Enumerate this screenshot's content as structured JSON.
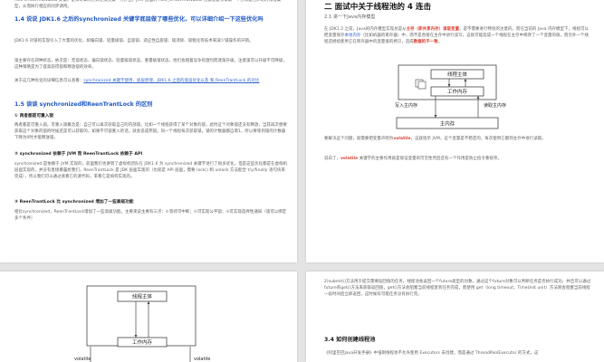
{
  "top_left": {
    "intro": "ACC SYNCHRONIZED 关键，使得可靠的方式更加完美一点并且，JVM 层面的 ACC_SYNCHRONIZED 也都会是有帮助一个方法是否声明的线程类型，从而执行相应的同步调用。",
    "s14_title": "1.4 说说 JDK1.6 之后的synchronized 关键字底层做了哪些优化，可以详细介绍一下这些优化吗",
    "s14_p1": "JDK1.6 对锁的实现引入了大量的优化，如偏向锁、轻量级锁、自旋锁、适应性自旋锁、锁消除、锁粗化等技术来减少锁操作的开销。",
    "s14_p2": "锁主要存在四种状态，依次是：无锁状态、偏向锁状态、轻量级锁状态、重量级锁状态，他们会随着竞争的激烈而逐渐升级。注意锁可以升级不可降级，这种策略是为了提高获得锁和释放锁的效率。",
    "s14_p3_prefix": "关于这几种优化的详细信息可以查看：",
    "s14_p3_link": "synchronized 关键字使用、底层原理、JDK1.6 之后的底层优化以及 和 ReenTrantLock 的对比",
    "s15_title": "1.5 谈谈 synchronized和ReenTrantLock 的区别",
    "s15_h1": "① 两者都是可重入锁",
    "s15_p1": "两者都是可重入锁。可重入锁概念是：自己可以再次获取自己的内部锁。比如一个线程获得了某个对象的锁，此时这个对象锁还没有释放，当其再次想要获取这个对象的锁的时候还是可以获取的，如果不可锁重入的话，就会造成死锁。同一个线程每次获取锁，锁的计数器都自增1，所以要等到锁的计数器下降为0时才能释放锁。",
    "s15_h2": "② synchronized 依赖于 JVM 而 ReenTrantLock 依赖于 API",
    "s15_p2": "synchronized 是依赖于 JVM 实现的，前面我们也讲到了虚拟机团队在 JDK1.6 为 synchronized 关键字进行了很多优化，但是这些优化都是在虚拟机层面实现的，并没有直接暴露给我们。ReenTrantLock 是 JDK 层面实现的（也就是 API 层面，需要 lock() 和 unlock 方法配合 try/finally 语句块来完成），所以我们可以通过查看它的源代码，来看它是如何实现的。",
    "s15_h3": "③ ReenTrantLock 比 synchronized 增加了一些高级功能",
    "s15_p3": "相比synchronized，ReenTrantLock增加了一些高级功能。主要来说主要有三点：①等待可中断；②可实现公平锁；③可实现选择性通知（锁可以绑定多个条件）"
  },
  "top_right": {
    "section_title": "二 面试中关于线程池的 4 连击",
    "sub_title": "2.1 讲一下Java内存模型",
    "p1_a": "在 JDK1.2 之前，Java的内存模型实现总是从",
    "p1_red1": "主存（即共享内存）读取变量",
    "p1_b": "，是不需要进行特别的注意的。而在当前的 Java 内存模型下，线程可以把变量保存",
    "p1_blue": "本地内存",
    "p1_c": "（比如机器的寄存器）中，而不是直接在主存中进行读写。这就可能造成一个线程在主存中修改了一个变量的值，而另外一个线程还继续使用它在寄存器中的变量值的拷贝，造成",
    "p1_red2": "数据的不一致",
    "p1_d": "。",
    "diagram": {
      "thread": "线程主体",
      "work_mem": "工作内存",
      "write": "写入主内存",
      "read": "读取主内存",
      "main_mem": "主内存"
    },
    "p2_a": "要解决这个问题，就需要把变量声明为",
    "p2_red": "volatile",
    "p2_b": "，这就指示 JVM，这个变量是不稳定的，每次使用它都到主存中进行读取。",
    "p3_a": "说白了，",
    "p3_red": "volatile",
    "p3_b": " 关键字的主要作用就是保证变量的可见性然后还有一个作用是防止指令重排序。"
  },
  "bottom_left": {
    "thread": "线程主体",
    "work_mem": "工作内存",
    "volatile": "volatile"
  },
  "bottom_right": {
    "p1": "2)submit()方法用于提交需要返回值的任务。线程池会返回一个future类型的对象，通过这个future对象可以判断任务是否执行成功，并且可以通过future的get()方法来获取返回值，get()方法会阻塞当前线程直到任务完成，而使用 get（long timeout，TimeUnit unit）方法则会阻塞当前线程一段时间后立即返回，这时候有可能任务没有执行完。",
    "s34_title": "3.4 如何创建线程池",
    "p2_a": "《阿里巴巴Java开发手册》中强制线程池不允许使用 Executors 去创建，而是通过 ThreadPoolExecutor 的方式，这"
  }
}
